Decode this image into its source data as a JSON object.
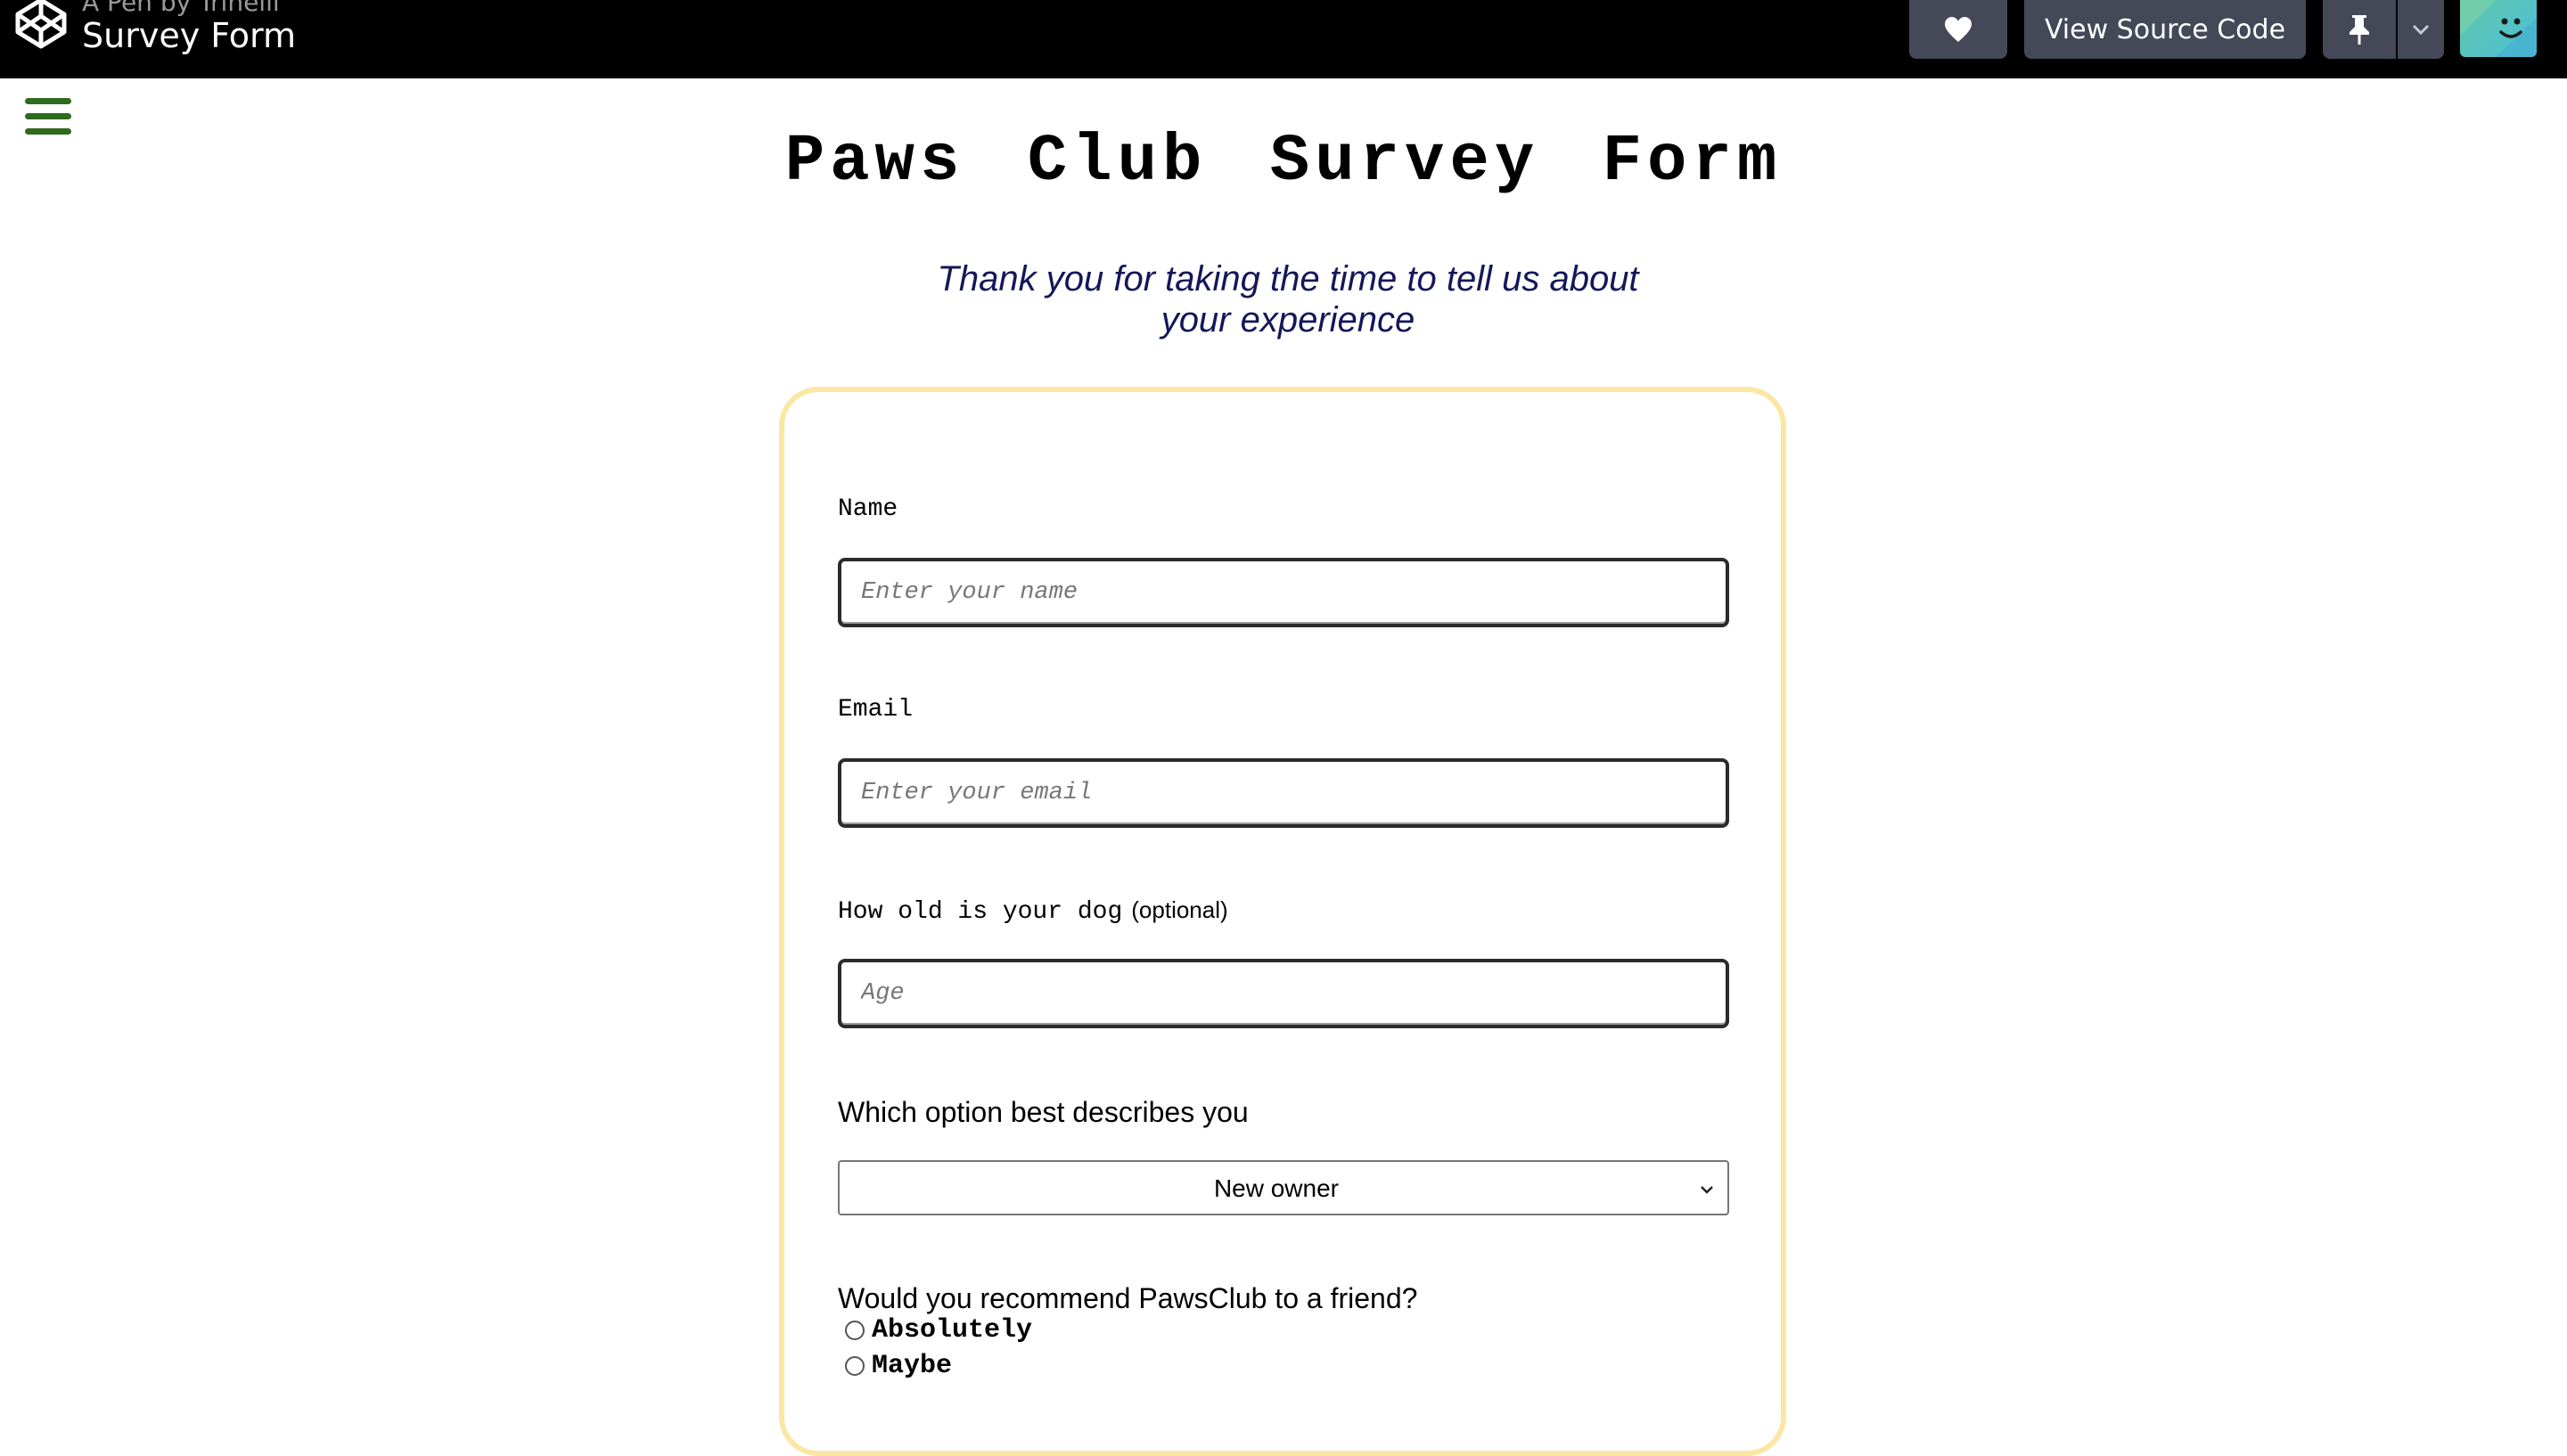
{
  "topbar": {
    "byline": "A Pen by Trinelli",
    "pen_title": "Survey Form",
    "view_source_label": "View Source Code"
  },
  "page": {
    "title": "Paws Club Survey Form",
    "subtitle": "Thank you for taking the time to tell us about your experience"
  },
  "form": {
    "name": {
      "label": "Name",
      "placeholder": "Enter your name"
    },
    "email": {
      "label": "Email",
      "placeholder": "Enter your email"
    },
    "age": {
      "label": "How old is your dog",
      "optional": "(optional)",
      "placeholder": "Age"
    },
    "role": {
      "label": "Which option best describes you",
      "selected": "New owner"
    },
    "recommend": {
      "question": "Would you recommend PawsClub to a friend?",
      "options": [
        "Absolutely",
        "Maybe"
      ]
    }
  },
  "colors": {
    "card_border": "#fbe7a4",
    "hamburger": "#2e6b1f",
    "subtitle": "#14175a",
    "topbar_button": "#444857"
  }
}
